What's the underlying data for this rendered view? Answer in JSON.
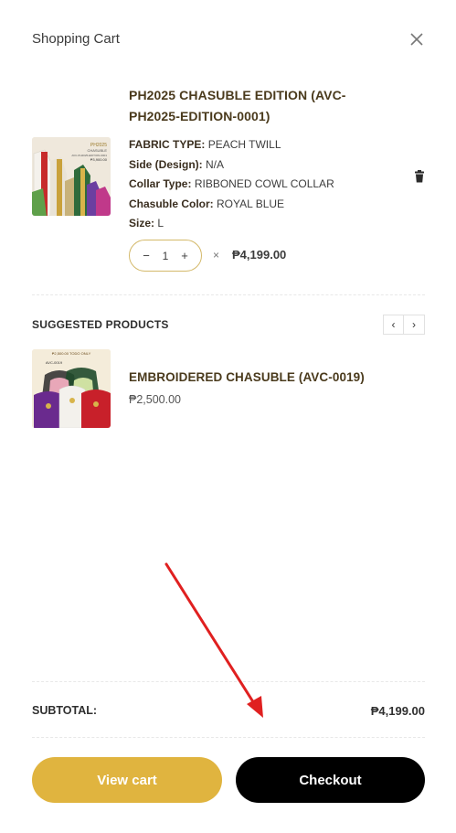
{
  "header": {
    "title": "Shopping Cart",
    "close_icon": "close-icon"
  },
  "cart_item": {
    "title": "PH2025 CHASUBLE EDITION (AVC-PH2025-EDITION-0001)",
    "attributes": [
      {
        "key": "FABRIC TYPE:",
        "value": "PEACH TWILL"
      },
      {
        "key": "Side (Design):",
        "value": "N/A"
      },
      {
        "key": "Collar Type:",
        "value": "RIBBONED COWL COLLAR"
      },
      {
        "key": "Chasuble Color:",
        "value": "ROYAL BLUE"
      },
      {
        "key": "Size:",
        "value": "L"
      }
    ],
    "quantity": {
      "minus": "−",
      "value": "1",
      "plus": "+"
    },
    "times": "×",
    "price": "₱4,199.00",
    "thumb_text": {
      "line1": "PH2025",
      "line2": "CHASUBLE",
      "line3": "AVC-PH2025-EDITION-0001",
      "line4": "₱3,900.00"
    },
    "remove_icon": "trash-icon"
  },
  "suggested": {
    "title": "SUGGESTED PRODUCTS",
    "prev_label": "‹",
    "next_label": "›",
    "items": [
      {
        "title": "EMBROIDERED CHASUBLE (AVC-0019)",
        "price": "₱2,500.00",
        "thumb_text": {
          "line1": "₱2,500.00 TODO ONLY",
          "line2": "AVC-0019"
        }
      }
    ]
  },
  "subtotal": {
    "label": "SUBTOTAL:",
    "value": "₱4,199.00"
  },
  "buttons": {
    "view_cart": "View cart",
    "checkout": "Checkout"
  },
  "colors": {
    "gold": "#e0b43f",
    "black": "#000000",
    "title_brown": "#4a3a1c",
    "annotation_red": "#e02020"
  }
}
